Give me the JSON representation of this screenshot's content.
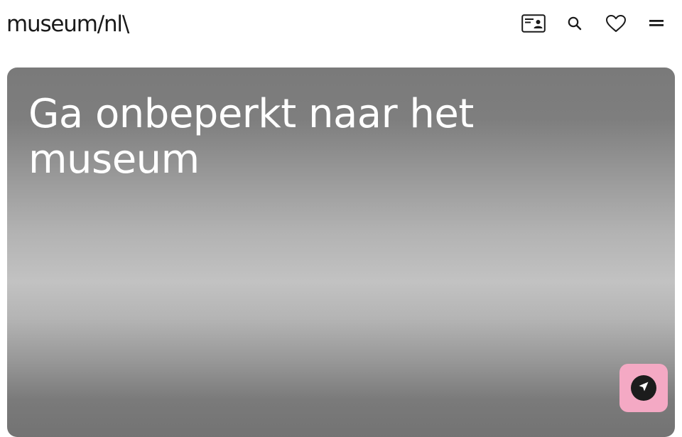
{
  "header": {
    "logo_text": "museum/nl\\",
    "icons": [
      "museumkaart-card-icon",
      "search-icon",
      "heart-icon",
      "menu-icon"
    ]
  },
  "hero": {
    "title": "Ga onbeperkt naar het museum"
  },
  "fab": {
    "icon": "navigation-arrow-icon"
  },
  "colors": {
    "text": "#1a1a1a",
    "fab_background": "#f4a9c4",
    "fab_inner": "#1c1c1c",
    "hero_title": "#ffffff"
  }
}
